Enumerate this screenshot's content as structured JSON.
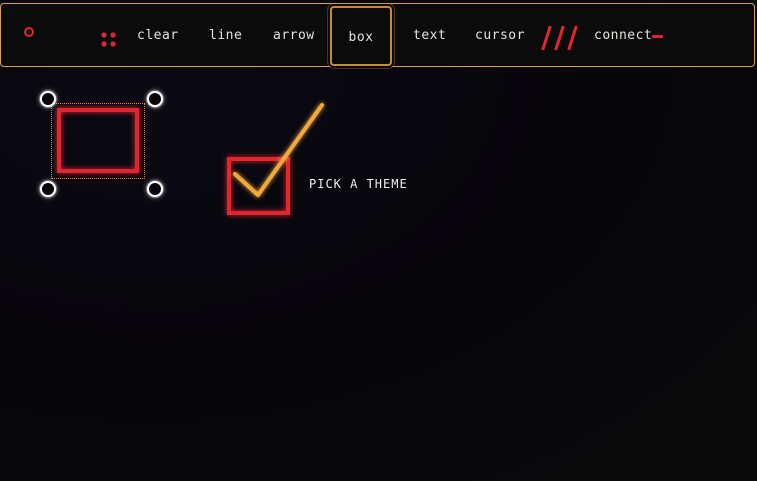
{
  "toolbar": {
    "tools": {
      "clear": "clear",
      "line": "line",
      "arrow": "arrow",
      "box": "box",
      "text": "text",
      "cursor": "cursor",
      "connect": "connect"
    },
    "active_tool": "box",
    "icons": {
      "left": "ring-icon",
      "before_clear": "dots-grid-icon",
      "before_connect": "slashes-icon",
      "after_connect": "dash-icon"
    }
  },
  "canvas": {
    "caption": "PICK A THEME"
  },
  "colors": {
    "accent_red": "#e0262f",
    "accent_amber": "#f2a93a",
    "toolbar_border": "#d9a24a",
    "handle": "#ffffff",
    "background": "#07060a"
  }
}
